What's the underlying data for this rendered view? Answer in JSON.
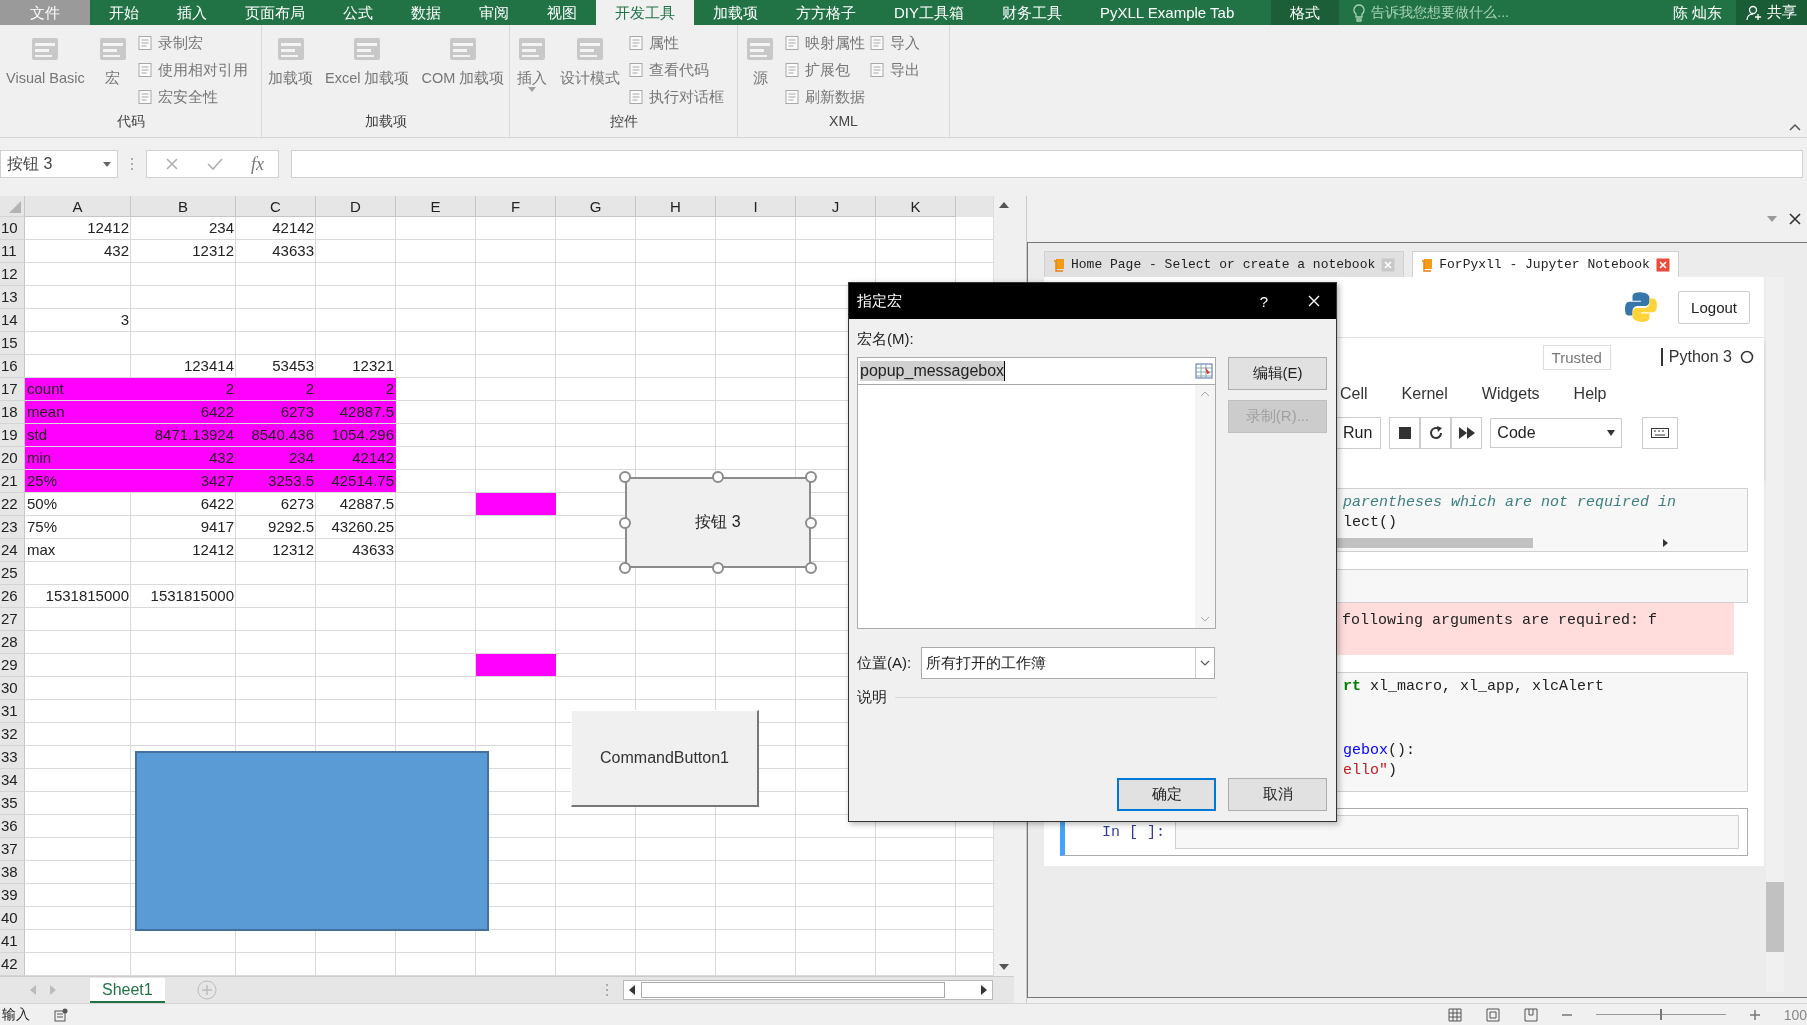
{
  "ribbon_tabs": [
    {
      "label": "文件",
      "kind": "file",
      "selected": false
    },
    {
      "label": "开始",
      "kind": "normal",
      "selected": false
    },
    {
      "label": "插入",
      "kind": "normal",
      "selected": false
    },
    {
      "label": "页面布局",
      "kind": "normal",
      "selected": false
    },
    {
      "label": "公式",
      "kind": "normal",
      "selected": false
    },
    {
      "label": "数据",
      "kind": "normal",
      "selected": false
    },
    {
      "label": "审阅",
      "kind": "normal",
      "selected": false
    },
    {
      "label": "视图",
      "kind": "normal",
      "selected": false
    },
    {
      "label": "开发工具",
      "kind": "normal",
      "selected": true
    },
    {
      "label": "加载项",
      "kind": "normal",
      "selected": false
    },
    {
      "label": "方方格子",
      "kind": "normal",
      "selected": false
    },
    {
      "label": "DIY工具箱",
      "kind": "normal",
      "selected": false
    },
    {
      "label": "财务工具",
      "kind": "normal",
      "selected": false
    },
    {
      "label": "PyXLL Example Tab",
      "kind": "normal",
      "selected": false
    },
    {
      "label": "格式",
      "kind": "context",
      "selected": false
    }
  ],
  "tell_me": "告诉我您想要做什么...",
  "user_name": "陈 灿东",
  "share_label": "共享",
  "ribbon_groups": [
    {
      "label": "代码",
      "large": [
        {
          "label": "Visual Basic",
          "dropdown": false
        },
        {
          "label": "宏",
          "dropdown": false
        }
      ],
      "small_columns": [
        [
          "录制宏",
          "使用相对引用",
          "宏安全性"
        ]
      ]
    },
    {
      "label": "加载项",
      "large": [
        {
          "label": "加载项",
          "dropdown": false
        },
        {
          "label": "Excel 加载项",
          "dropdown": false
        },
        {
          "label": "COM 加载项",
          "dropdown": false
        }
      ]
    },
    {
      "label": "控件",
      "large": [
        {
          "label": "插入",
          "dropdown": true
        },
        {
          "label": "设计模式",
          "dropdown": false
        }
      ],
      "small_columns": [
        [
          "属性",
          "查看代码",
          "执行对话框"
        ]
      ]
    },
    {
      "label": "XML",
      "large": [
        {
          "label": "源",
          "dropdown": false
        }
      ],
      "small_columns": [
        [
          "映射属性",
          "扩展包",
          "刷新数据"
        ],
        [
          "导入",
          "导出"
        ]
      ]
    }
  ],
  "name_box": "按钮 3",
  "function_label": "fx",
  "columns": [
    "A",
    "B",
    "C",
    "D",
    "E",
    "F",
    "G",
    "H",
    "I",
    "J",
    "K"
  ],
  "rows": [
    {
      "header": "10",
      "kind": "numbers",
      "cells": [
        {
          "text": "12412"
        },
        {
          "text": "234"
        },
        {
          "text": "42142"
        }
      ]
    },
    {
      "header": "11",
      "kind": "numbers",
      "cells": [
        {
          "text": "432"
        },
        {
          "text": "12312"
        },
        {
          "text": "43633"
        }
      ]
    },
    {
      "header": "12"
    },
    {
      "header": "13"
    },
    {
      "header": "14",
      "kind": "numbers",
      "cells": [
        {
          "text": "3"
        }
      ]
    },
    {
      "header": "15"
    },
    {
      "header": "16",
      "kind": "numbers",
      "cells": [
        null,
        {
          "text": "123414"
        },
        {
          "text": "53453"
        },
        {
          "text": "12321"
        }
      ]
    },
    {
      "header": "17",
      "kind": "stats",
      "cells": [
        {
          "text": "count",
          "highlighted": true
        },
        {
          "text": "2",
          "highlighted": true
        },
        {
          "text": "2",
          "highlighted": true
        },
        {
          "text": "2",
          "highlighted": true
        }
      ]
    },
    {
      "header": "18",
      "kind": "stats",
      "cells": [
        {
          "text": "mean",
          "highlighted": true
        },
        {
          "text": "6422",
          "highlighted": true
        },
        {
          "text": "6273",
          "highlighted": true
        },
        {
          "text": "42887.5",
          "highlighted": true
        }
      ]
    },
    {
      "header": "19",
      "kind": "stats",
      "cells": [
        {
          "text": "std",
          "highlighted": true
        },
        {
          "text": "8471.13924",
          "highlighted": true
        },
        {
          "text": "8540.436",
          "highlighted": true
        },
        {
          "text": "1054.296",
          "highlighted": true
        }
      ]
    },
    {
      "header": "20",
      "kind": "stats",
      "cells": [
        {
          "text": "min",
          "highlighted": true
        },
        {
          "text": "432",
          "highlighted": true
        },
        {
          "text": "234",
          "highlighted": true
        },
        {
          "text": "42142",
          "highlighted": true
        }
      ]
    },
    {
      "header": "21",
      "kind": "stats",
      "cells": [
        {
          "text": "25%",
          "highlighted": true
        },
        {
          "text": "3427",
          "highlighted": true
        },
        {
          "text": "3253.5",
          "highlighted": true
        },
        {
          "text": "42514.75",
          "highlighted": true
        }
      ]
    },
    {
      "header": "22",
      "kind": "stats",
      "cells": [
        {
          "text": "50%"
        },
        {
          "text": "6422"
        },
        {
          "text": "6273"
        },
        {
          "text": "42887.5"
        },
        null,
        {
          "highlighted": true
        }
      ]
    },
    {
      "header": "23",
      "kind": "stats",
      "cells": [
        {
          "text": "75%"
        },
        {
          "text": "9417"
        },
        {
          "text": "9292.5"
        },
        {
          "text": "43260.25"
        }
      ]
    },
    {
      "header": "24",
      "kind": "stats",
      "cells": [
        {
          "text": "max"
        },
        {
          "text": "12412"
        },
        {
          "text": "12312"
        },
        {
          "text": "43633"
        }
      ]
    },
    {
      "header": "25"
    },
    {
      "header": "26",
      "kind": "numbers",
      "cells": [
        {
          "text": "1531815000"
        },
        {
          "text": "1531815000"
        }
      ]
    },
    {
      "header": "27"
    },
    {
      "header": "28"
    },
    {
      "header": "29",
      "kind": "numbers",
      "cells": [
        null,
        null,
        null,
        null,
        null,
        {
          "highlighted": true
        }
      ]
    },
    {
      "header": "30"
    },
    {
      "header": "31"
    },
    {
      "header": "32"
    },
    {
      "header": "33"
    },
    {
      "header": "34"
    },
    {
      "header": "35"
    },
    {
      "header": "36"
    },
    {
      "header": "37"
    },
    {
      "header": "38"
    },
    {
      "header": "39"
    },
    {
      "header": "40"
    },
    {
      "header": "41"
    },
    {
      "header": "42"
    }
  ],
  "shapes": [
    {
      "kind": "form_button",
      "label": "按钮 3",
      "selected": true
    },
    {
      "kind": "command_button",
      "label": "CommandButton1",
      "selected": false
    },
    {
      "kind": "rectangle",
      "selected": false
    }
  ],
  "sheet_tabs": [
    {
      "label": "Sheet1",
      "selected": true
    }
  ],
  "status_text": "输入",
  "zoom": {
    "level": 0.5,
    "label": "100"
  },
  "jupyter": {
    "browser_tabs": [
      {
        "title": "Home Page - Select or create a notebook",
        "selected": false
      },
      {
        "title": "ForPyxll - Jupyter Notebook",
        "selected": true
      }
    ],
    "logout": "Logout",
    "trusted": "Trusted",
    "kernel": "Python 3",
    "menu": [
      "Cell",
      "Kernel",
      "Widgets",
      "Help"
    ],
    "run_label": "Run",
    "cell_type": "Code",
    "cells": [
      {
        "kind": "code",
        "scrollbar": true,
        "blocks": [
          [
            {
              "tokens": [
                {
                  "kind": "comment",
                  "text": "parentheses which are not required in"
                }
              ]
            },
            {
              "tokens": [
                {
                  "kind": "plain",
                  "text": "lect()"
                }
              ]
            }
          ]
        ]
      },
      {
        "kind": "code",
        "scrollbar": false
      },
      {
        "kind": "error",
        "blocks": [
          [
            {
              "tokens": [
                {
                  "kind": "plain",
                  "text": "following arguments are required: f"
                }
              ]
            }
          ]
        ]
      },
      {
        "kind": "code",
        "scrollbar": false,
        "blocks": [
          [
            {
              "tokens": [
                {
                  "kind": "keyword",
                  "text": "rt"
                },
                {
                  "kind": "plain",
                  "text": " xl_macro, xl_app, xlcAlert"
                }
              ]
            }
          ],
          [
            {
              "tokens": [
                {
                  "kind": "name",
                  "text": "gebox"
                },
                {
                  "kind": "plain",
                  "text": "():"
                }
              ]
            },
            {
              "tokens": [
                {
                  "kind": "string",
                  "text": "ello\""
                },
                {
                  "kind": "plain",
                  "text": ")"
                }
              ]
            }
          ]
        ]
      },
      {
        "kind": "prompt",
        "prompt": "In [ ]:",
        "selected": true
      }
    ]
  },
  "dialog": {
    "title": "指定宏",
    "help": "?",
    "name_label": "宏名(M):",
    "name_value": "popup_messagebox",
    "side_buttons": [
      {
        "label": "编辑(E)",
        "disabled": false
      },
      {
        "label": "录制(R)...",
        "disabled": true
      }
    ],
    "location_label": "位置(A):",
    "location_value": "所有打开的工作簿",
    "description_label": "说明",
    "footer_buttons": [
      {
        "label": "确定",
        "default": true
      },
      {
        "label": "取消",
        "default": false
      }
    ]
  }
}
